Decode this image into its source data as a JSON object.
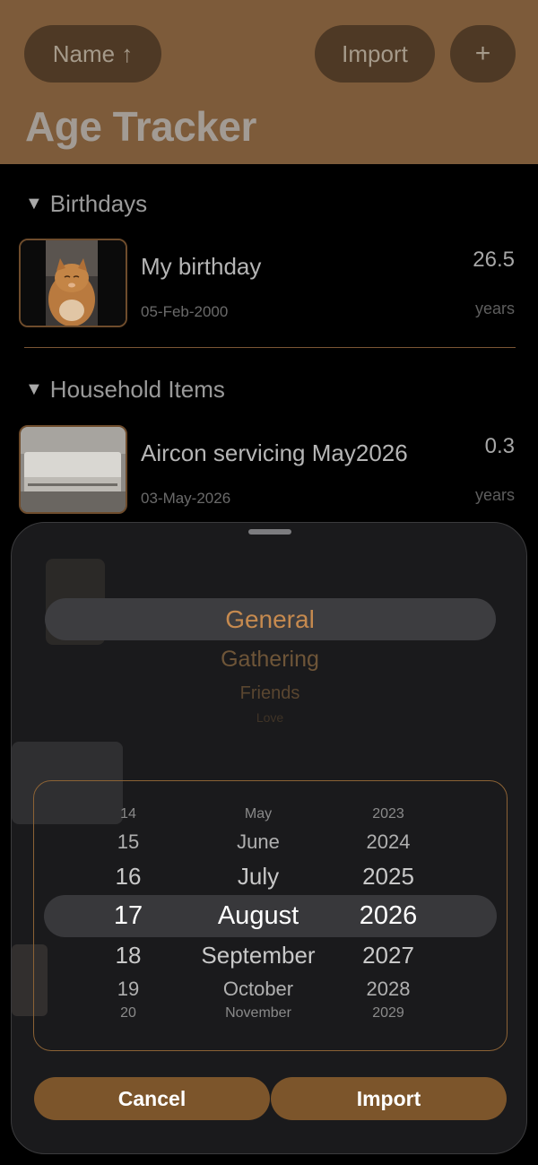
{
  "header": {
    "sort_label": "Name ↑",
    "import_label": "Import",
    "add_label": "+",
    "title": "Age Tracker"
  },
  "sections": [
    {
      "name": "Birthdays",
      "items": [
        {
          "title": "My birthday",
          "date": "05-Feb-2000",
          "value": "26.5",
          "unit": "years",
          "thumb_icon": "cat-photo"
        }
      ]
    },
    {
      "name": "Household Items",
      "items": [
        {
          "title": "Aircon servicing May2026",
          "date": "03-May-2026",
          "value": "0.3",
          "unit": "years",
          "thumb_icon": "aircon-photo"
        }
      ]
    }
  ],
  "import_sheet": {
    "categories": [
      "General",
      "Gathering",
      "Friends",
      "Love"
    ],
    "selected_category": "General",
    "date_rows": [
      {
        "day": "14",
        "month": "May",
        "year": "2023"
      },
      {
        "day": "15",
        "month": "June",
        "year": "2024"
      },
      {
        "day": "16",
        "month": "July",
        "year": "2025"
      },
      {
        "day": "17",
        "month": "August",
        "year": "2026"
      },
      {
        "day": "18",
        "month": "September",
        "year": "2027"
      },
      {
        "day": "19",
        "month": "October",
        "year": "2028"
      },
      {
        "day": "20",
        "month": "November",
        "year": "2029"
      }
    ],
    "selected_date": {
      "day": "17",
      "month": "August",
      "year": "2026"
    },
    "cancel_label": "Cancel",
    "import_label": "Import"
  },
  "colors": {
    "accent": "#c68a4f",
    "header_bg": "#7d5b3a",
    "button_bg": "#7c552b"
  }
}
